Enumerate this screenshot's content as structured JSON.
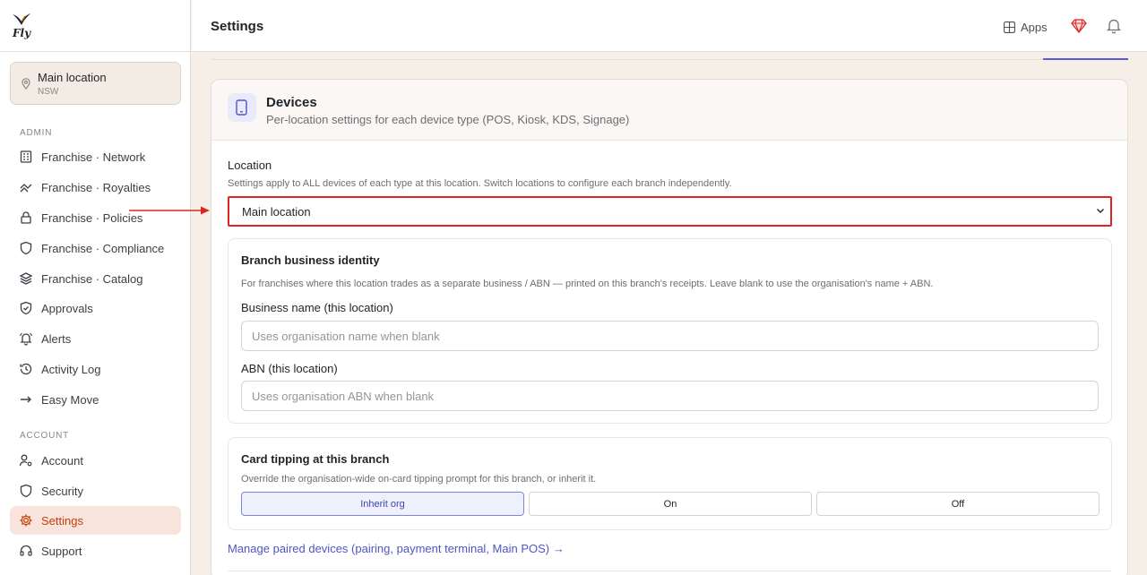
{
  "brand": {
    "logo_text": "Fly"
  },
  "location_switcher": {
    "name": "Main location",
    "region": "NSW"
  },
  "sidebar": {
    "admin_label": "ADMIN",
    "admin_items": [
      {
        "label": "Franchise · Network",
        "icon": "building-icon"
      },
      {
        "label": "Franchise · Royalties",
        "icon": "royalties-icon"
      },
      {
        "label": "Franchise · Policies",
        "icon": "lock-icon"
      },
      {
        "label": "Franchise · Compliance",
        "icon": "shield-icon"
      },
      {
        "label": "Franchise · Catalog",
        "icon": "layers-icon"
      },
      {
        "label": "Approvals",
        "icon": "shield-check-icon"
      },
      {
        "label": "Alerts",
        "icon": "bell-alert-icon"
      },
      {
        "label": "Activity Log",
        "icon": "clock-icon"
      },
      {
        "label": "Easy Move",
        "icon": "arrow-right-icon"
      }
    ],
    "account_label": "ACCOUNT",
    "account_items": [
      {
        "label": "Account",
        "icon": "user-cog-icon"
      },
      {
        "label": "Security",
        "icon": "shield-icon"
      },
      {
        "label": "Settings",
        "icon": "gear-icon",
        "active": true
      },
      {
        "label": "Support",
        "icon": "headset-icon"
      }
    ]
  },
  "header": {
    "title": "Settings",
    "apps_label": "Apps"
  },
  "devices": {
    "title": "Devices",
    "subtitle": "Per-location settings for each device type (POS, Kiosk, KDS, Signage)",
    "location_label": "Location",
    "location_help": "Settings apply to ALL devices of each type at this location. Switch locations to configure each branch independently.",
    "location_value": "Main location",
    "identity": {
      "title": "Branch business identity",
      "help": "For franchises where this location trades as a separate business / ABN — printed on this branch's receipts. Leave blank to use the organisation's name + ABN.",
      "business_name_label": "Business name (this location)",
      "business_name_placeholder": "Uses organisation name when blank",
      "abn_label": "ABN (this location)",
      "abn_placeholder": "Uses organisation ABN when blank"
    },
    "tipping": {
      "title": "Card tipping at this branch",
      "help": "Override the organisation-wide on-card tipping prompt for this branch, or inherit it.",
      "options": [
        "Inherit org",
        "On",
        "Off"
      ],
      "selected": "Inherit org"
    },
    "manage_link": "Manage paired devices (pairing, payment terminal, Main POS) →"
  },
  "colors": {
    "accent": "#5b5bd6",
    "brand": "#c2410c",
    "annotation": "#dc2626"
  }
}
